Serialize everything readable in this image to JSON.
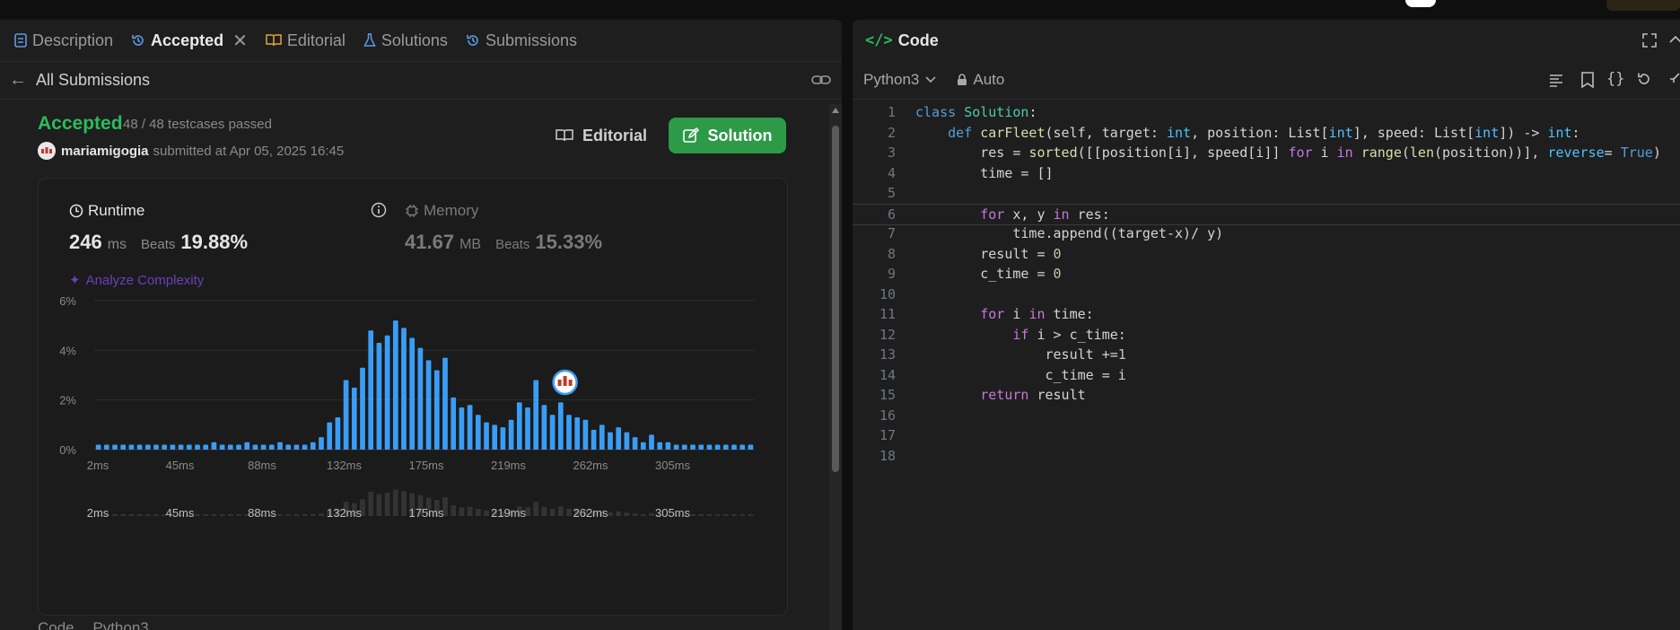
{
  "tabs": [
    {
      "label": "Description"
    },
    {
      "label": "Accepted"
    },
    {
      "label": "Editorial"
    },
    {
      "label": "Solutions"
    },
    {
      "label": "Submissions"
    }
  ],
  "sub": {
    "back_label": "All Submissions"
  },
  "result": {
    "status": "Accepted",
    "testcases": "48 / 48 testcases passed",
    "user": "mariamigogia",
    "submitted": "submitted at Apr 05, 2025 16:45",
    "editorial_btn": "Editorial",
    "solution_btn": "Solution"
  },
  "runtime": {
    "label": "Runtime",
    "value": "246",
    "unit": "ms",
    "beats_label": "Beats",
    "beats": "19.88%"
  },
  "memory": {
    "label": "Memory",
    "value": "41.67",
    "unit": "MB",
    "beats_label": "Beats",
    "beats": "15.33%"
  },
  "analyze": "Analyze Complexity",
  "chart_data": {
    "type": "bar",
    "yticks": [
      "6%",
      "4%",
      "2%",
      "0%"
    ],
    "ylim": [
      0,
      6
    ],
    "xticks": [
      "2ms",
      "45ms",
      "88ms",
      "132ms",
      "175ms",
      "219ms",
      "262ms",
      "305ms"
    ],
    "values": [
      0.2,
      0.2,
      0.2,
      0.2,
      0.2,
      0.2,
      0.2,
      0.2,
      0.2,
      0.2,
      0.2,
      0.2,
      0.2,
      0.2,
      0.3,
      0.2,
      0.2,
      0.2,
      0.3,
      0.2,
      0.2,
      0.2,
      0.3,
      0.2,
      0.2,
      0.2,
      0.3,
      0.5,
      1.1,
      1.3,
      2.8,
      2.5,
      3.3,
      4.8,
      4.3,
      4.6,
      5.2,
      4.9,
      4.5,
      4.1,
      3.6,
      3.2,
      3.7,
      2.1,
      1.7,
      1.8,
      1.4,
      1.1,
      1.0,
      0.9,
      1.2,
      1.9,
      1.7,
      2.8,
      1.8,
      1.4,
      1.9,
      1.4,
      1.3,
      1.2,
      0.8,
      1.0,
      0.7,
      0.9,
      0.7,
      0.5,
      0.3,
      0.6,
      0.3,
      0.3,
      0.2,
      0.2,
      0.2,
      0.2,
      0.2,
      0.2,
      0.2,
      0.2,
      0.2,
      0.2
    ],
    "highlight_index": 55,
    "colors": {
      "bar": "#3a9df5",
      "grid": "#2e2e2e",
      "mini": "#333333"
    }
  },
  "bottom": {
    "code": "Code",
    "lang": "Python3"
  },
  "editor": {
    "title": "Code",
    "lang": "Python3",
    "mode": "Auto",
    "lines": [
      "1",
      "2",
      "3",
      "4",
      "5",
      "6",
      "7",
      "8",
      "9",
      "10",
      "11",
      "12",
      "13",
      "14",
      "15",
      "16",
      "17",
      "18"
    ]
  }
}
